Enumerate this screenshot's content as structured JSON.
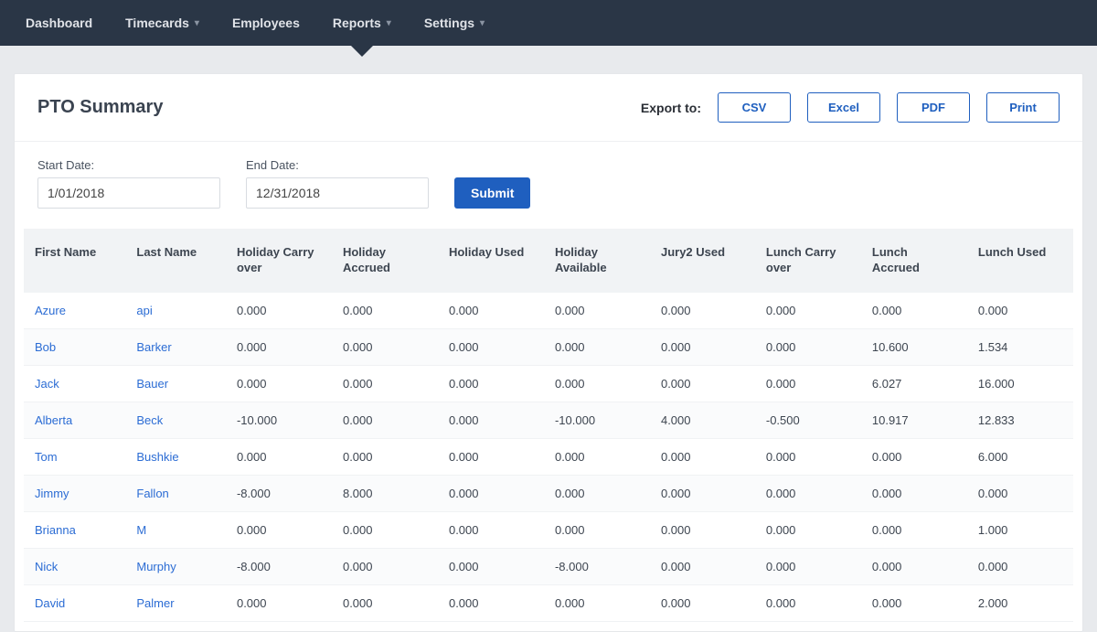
{
  "nav": {
    "items": [
      {
        "label": "Dashboard",
        "chevron": false
      },
      {
        "label": "Timecards",
        "chevron": true
      },
      {
        "label": "Employees",
        "chevron": false
      },
      {
        "label": "Reports",
        "chevron": true,
        "active": true
      },
      {
        "label": "Settings",
        "chevron": true
      }
    ]
  },
  "page": {
    "title": "PTO Summary",
    "export_label": "Export to:",
    "export_buttons": [
      "CSV",
      "Excel",
      "PDF",
      "Print"
    ]
  },
  "filters": {
    "start_label": "Start Date:",
    "start_value": "1/01/2018",
    "end_label": "End Date:",
    "end_value": "12/31/2018",
    "submit_label": "Submit"
  },
  "table": {
    "columns": [
      "First Name",
      "Last Name",
      "Holiday Carry over",
      "Holiday Accrued",
      "Holiday Used",
      "Holiday Available",
      "Jury2 Used",
      "Lunch Carry over",
      "Lunch Accrued",
      "Lunch Used"
    ],
    "rows": [
      {
        "first": "Azure",
        "last": "api",
        "v": [
          "0.000",
          "0.000",
          "0.000",
          "0.000",
          "0.000",
          "0.000",
          "0.000",
          "0.000"
        ]
      },
      {
        "first": "Bob",
        "last": "Barker",
        "v": [
          "0.000",
          "0.000",
          "0.000",
          "0.000",
          "0.000",
          "0.000",
          "10.600",
          "1.534"
        ]
      },
      {
        "first": "Jack",
        "last": "Bauer",
        "v": [
          "0.000",
          "0.000",
          "0.000",
          "0.000",
          "0.000",
          "0.000",
          "6.027",
          "16.000"
        ]
      },
      {
        "first": "Alberta",
        "last": "Beck",
        "v": [
          "-10.000",
          "0.000",
          "0.000",
          "-10.000",
          "4.000",
          "-0.500",
          "10.917",
          "12.833"
        ]
      },
      {
        "first": "Tom",
        "last": "Bushkie",
        "v": [
          "0.000",
          "0.000",
          "0.000",
          "0.000",
          "0.000",
          "0.000",
          "0.000",
          "6.000"
        ]
      },
      {
        "first": "Jimmy",
        "last": "Fallon",
        "v": [
          "-8.000",
          "8.000",
          "0.000",
          "0.000",
          "0.000",
          "0.000",
          "0.000",
          "0.000"
        ]
      },
      {
        "first": "Brianna",
        "last": "M",
        "v": [
          "0.000",
          "0.000",
          "0.000",
          "0.000",
          "0.000",
          "0.000",
          "0.000",
          "1.000"
        ]
      },
      {
        "first": "Nick",
        "last": "Murphy",
        "v": [
          "-8.000",
          "0.000",
          "0.000",
          "-8.000",
          "0.000",
          "0.000",
          "0.000",
          "0.000"
        ]
      },
      {
        "first": "David",
        "last": "Palmer",
        "v": [
          "0.000",
          "0.000",
          "0.000",
          "0.000",
          "0.000",
          "0.000",
          "0.000",
          "2.000"
        ]
      }
    ]
  }
}
